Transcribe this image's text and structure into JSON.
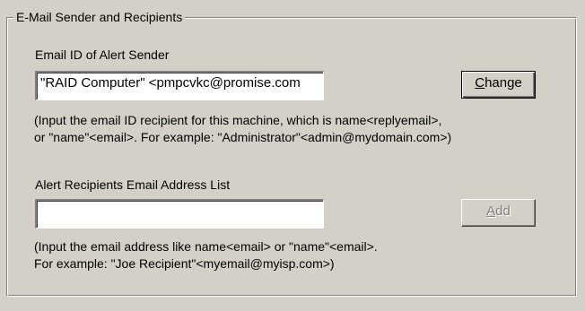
{
  "group": {
    "title": "E-Mail Sender and Recipients"
  },
  "sender": {
    "label": "Email ID of Alert Sender",
    "value": "\"RAID Computer\" <pmpcvkc@promise.com",
    "change_button": {
      "mnemonic": "C",
      "rest": "hange",
      "enabled": true
    },
    "hint_line1": "(Input the email ID recipient for this machine, which is name<replyemail>,",
    "hint_line2": "or \"name\"<email>. For example: \"Administrator\"<admin@mydomain.com>)"
  },
  "recipients": {
    "label": "Alert Recipients Email Address List",
    "value": "",
    "add_button": {
      "mnemonic": "A",
      "rest": "dd",
      "enabled": false
    },
    "hint_line1": "(Input the email address like name<email> or \"name\"<email>.",
    "hint_line2": "For example: \"Joe Recipient\"<myemail@myisp.com>)"
  },
  "colors": {
    "face": "#d4d0c8",
    "shadow": "#808080",
    "highlight": "#ffffff",
    "disabled_text": "#808080"
  }
}
